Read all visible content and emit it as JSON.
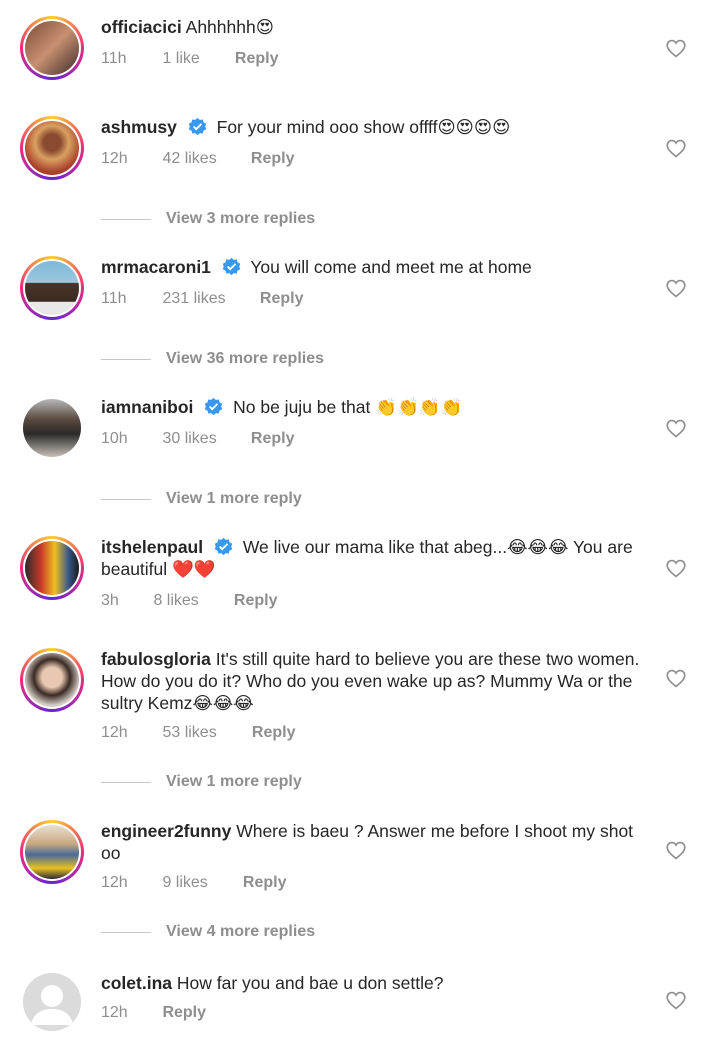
{
  "comments": [
    {
      "username": "officiacici",
      "verified": false,
      "text": "Ahhhhhh😍",
      "time": "11h",
      "likes": "1 like",
      "reply": "Reply",
      "view_replies": ""
    },
    {
      "username": "ashmusy",
      "verified": true,
      "text": "For your mind ooo show offff😍😍😍😍",
      "time": "12h",
      "likes": "42 likes",
      "reply": "Reply",
      "view_replies": "View 3 more replies"
    },
    {
      "username": "mrmacaroni1",
      "verified": true,
      "text": "You will come and meet me at home",
      "time": "11h",
      "likes": "231 likes",
      "reply": "Reply",
      "view_replies": "View 36 more replies"
    },
    {
      "username": "iamnaniboi",
      "verified": true,
      "text": "No be juju be that 👏👏👏👏",
      "time": "10h",
      "likes": "30 likes",
      "reply": "Reply",
      "view_replies": "View 1 more reply"
    },
    {
      "username": "itshelenpaul",
      "verified": true,
      "text": "We live our mama like that abeg...😂😂😂 You are beautiful ❤️❤️",
      "time": "3h",
      "likes": "8 likes",
      "reply": "Reply",
      "view_replies": ""
    },
    {
      "username": "fabulosgloria",
      "verified": false,
      "text": "It's still quite hard to believe you are these two women. How do you do it? Who do you even wake up as? Mummy Wa or the sultry Kemz😂😂😂",
      "time": "12h",
      "likes": "53 likes",
      "reply": "Reply",
      "view_replies": "View 1 more reply"
    },
    {
      "username": "engineer2funny",
      "verified": false,
      "text": "Where is baeu ? Answer me before I shoot my shot oo",
      "time": "12h",
      "likes": "9 likes",
      "reply": "Reply",
      "view_replies": "View 4 more replies"
    },
    {
      "username": "colet.ina",
      "verified": false,
      "text": "How far you and bae u don settle?",
      "time": "12h",
      "likes": "",
      "reply": "Reply",
      "view_replies": ""
    }
  ],
  "colors": {
    "text": "#262626",
    "secondary": "#8e8e8e",
    "verified": "#3897f0",
    "divider": "#c7c7c7"
  }
}
